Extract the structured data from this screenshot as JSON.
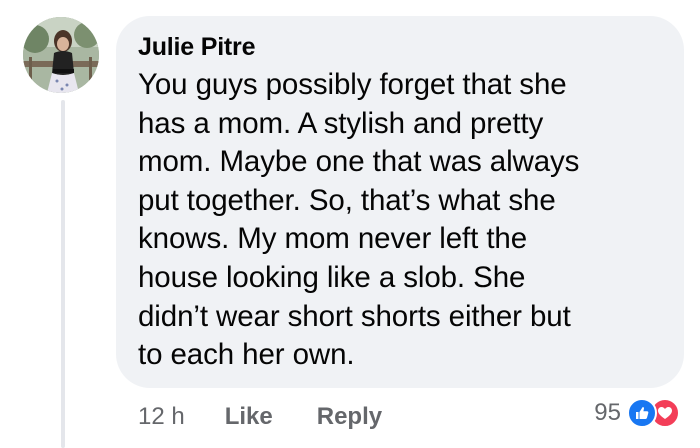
{
  "comment": {
    "author": "Julie Pitre",
    "lines": [
      "You guys possibly forget that she",
      "has a mom. A stylish and pretty",
      "mom. Maybe one that was always",
      "put together. So, that’s what she",
      "knows. My mom never left the",
      "house looking like a slob. She",
      "didn’t wear short shorts either but",
      "to each her own."
    ]
  },
  "actions": {
    "time": "12 h",
    "like_label": "Like",
    "reply_label": "Reply"
  },
  "reactions": {
    "count": "95",
    "icons": [
      "like-icon",
      "love-icon"
    ]
  },
  "colors": {
    "bubble": "#f0f2f5",
    "text": "#050505",
    "muted": "#65676b",
    "like": "#1877f2",
    "love": "#f33e58"
  }
}
